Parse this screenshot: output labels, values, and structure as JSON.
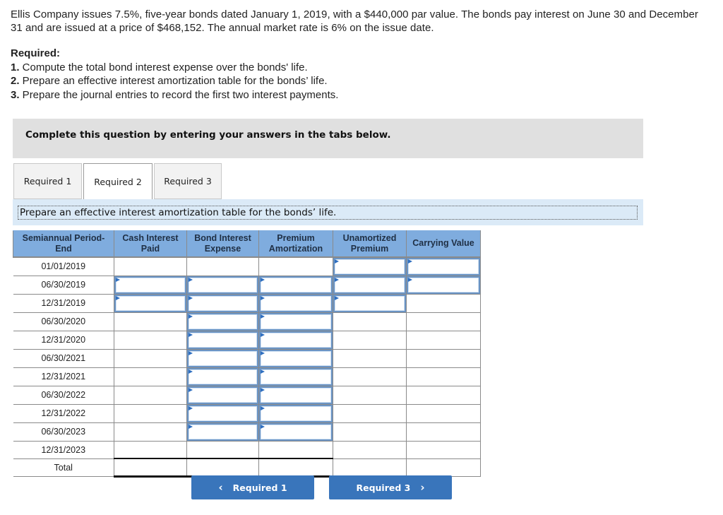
{
  "problem": {
    "text": "Ellis Company issues 7.5%, five-year bonds dated January 1, 2019, with a $440,000 par value. The bonds pay interest on June 30 and December 31 and are issued at a price of $468,152. The annual market rate is 6% on the issue date."
  },
  "required": {
    "heading": "Required:",
    "items": [
      {
        "num": "1.",
        "text": " Compute the total bond interest expense over the bonds' life."
      },
      {
        "num": "2.",
        "text": " Prepare an effective interest amortization table for the bonds’ life."
      },
      {
        "num": "3.",
        "text": " Prepare the journal entries to record the first two interest payments."
      }
    ]
  },
  "banner": {
    "text": "Complete this question by entering your answers in the tabs below."
  },
  "tabs": [
    {
      "label": "Required 1",
      "active": false
    },
    {
      "label": "Required 2",
      "active": true
    },
    {
      "label": "Required 3",
      "active": false
    }
  ],
  "instruction": "Prepare an effective interest amortization table for the bonds’ life.",
  "table": {
    "headers": [
      "Semiannual Period-\nEnd",
      "Cash Interest\nPaid",
      "Bond Interest\nExpense",
      "Premium\nAmortization",
      "Unamortized\nPremium",
      "Carrying Value"
    ],
    "rows": [
      {
        "label": "01/01/2019",
        "inputs": [
          false,
          false,
          false,
          true,
          true
        ],
        "values": [
          "",
          "",
          "",
          "",
          ""
        ]
      },
      {
        "label": "06/30/2019",
        "inputs": [
          true,
          true,
          true,
          true,
          true
        ],
        "values": [
          "",
          "",
          "",
          "",
          ""
        ]
      },
      {
        "label": "12/31/2019",
        "inputs": [
          true,
          true,
          true,
          true,
          false
        ],
        "values": [
          "",
          "",
          "",
          "",
          ""
        ]
      },
      {
        "label": "06/30/2020",
        "inputs": [
          false,
          true,
          true,
          false,
          false
        ],
        "values": [
          "",
          "",
          "",
          "",
          ""
        ]
      },
      {
        "label": "12/31/2020",
        "inputs": [
          false,
          true,
          true,
          false,
          false
        ],
        "values": [
          "",
          "",
          "",
          "",
          ""
        ]
      },
      {
        "label": "06/30/2021",
        "inputs": [
          false,
          true,
          true,
          false,
          false
        ],
        "values": [
          "",
          "",
          "",
          "",
          ""
        ]
      },
      {
        "label": "12/31/2021",
        "inputs": [
          false,
          true,
          true,
          false,
          false
        ],
        "values": [
          "",
          "",
          "",
          "",
          ""
        ]
      },
      {
        "label": "06/30/2022",
        "inputs": [
          false,
          true,
          true,
          false,
          false
        ],
        "values": [
          "",
          "",
          "",
          "",
          ""
        ]
      },
      {
        "label": "12/31/2022",
        "inputs": [
          false,
          true,
          true,
          false,
          false
        ],
        "values": [
          "",
          "",
          "",
          "",
          ""
        ]
      },
      {
        "label": "06/30/2023",
        "inputs": [
          false,
          true,
          true,
          false,
          false
        ],
        "values": [
          "",
          "",
          "",
          "",
          ""
        ]
      },
      {
        "label": "12/31/2023",
        "inputs": [
          false,
          false,
          false,
          false,
          false
        ],
        "values": [
          "",
          "",
          "",
          "",
          ""
        ]
      }
    ],
    "total_label": "Total"
  },
  "nav": {
    "prev_label": "Required 1",
    "next_label": "Required 3",
    "prev_icon": "chevron-left-icon",
    "next_icon": "chevron-right-icon"
  },
  "colors": {
    "header_bg": "#7facde",
    "input_border": "#6b94c4",
    "button_bg": "#3975bb",
    "instruction_bg": "#dbeaf7",
    "banner_bg": "#e0e0e0"
  }
}
